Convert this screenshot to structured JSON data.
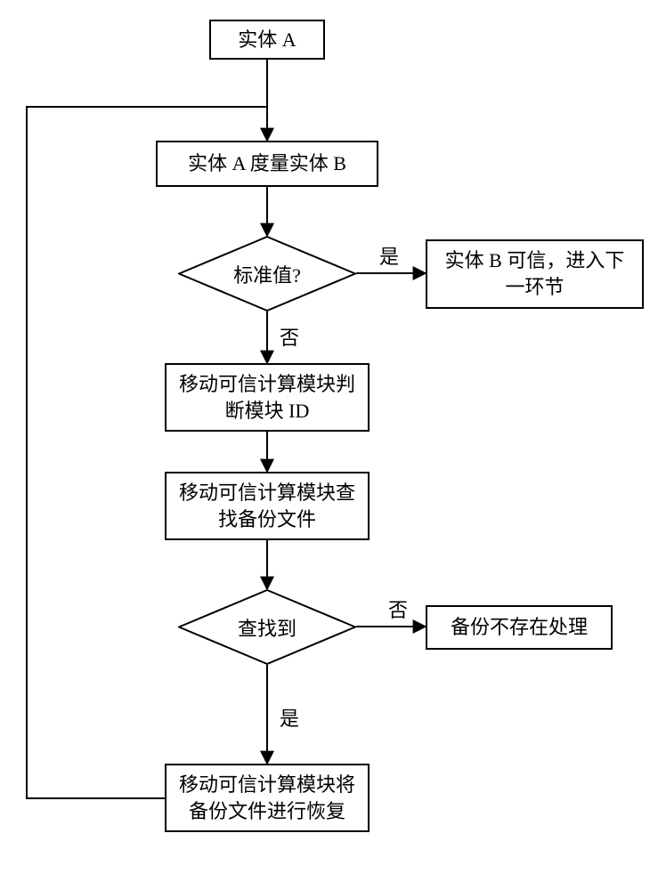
{
  "nodes": {
    "start": "实体 A",
    "measure": "实体 A 度量实体 B",
    "check_std": "标准值?",
    "trusted": "实体 B 可信，进入下\n一环节",
    "judge_id": "移动可信计算模块判\n断模块 ID",
    "find_backup": "移动可信计算模块查\n找备份文件",
    "found": "查找到",
    "not_exist": "备份不存在处理",
    "restore": "移动可信计算模块将\n备份文件进行恢复"
  },
  "edges": {
    "yes": "是",
    "no": "否"
  }
}
